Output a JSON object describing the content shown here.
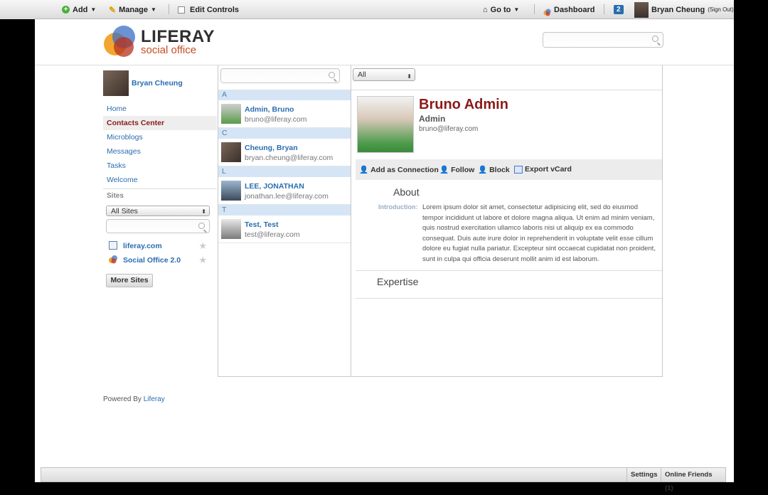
{
  "dockbar": {
    "add_label": "Add",
    "manage_label": "Manage",
    "edit_controls_label": "Edit Controls",
    "goto_label": "Go to",
    "dashboard_label": "Dashboard",
    "notification_count": "2",
    "user_name": "Bryan Cheung",
    "sign_out_label": "(Sign Out)"
  },
  "logo": {
    "main": "LIFERAY",
    "sub": "social office"
  },
  "sidebar": {
    "user_name": "Bryan Cheung",
    "nav_items": [
      {
        "label": "Home"
      },
      {
        "label": "Contacts Center",
        "active": true
      },
      {
        "label": "Microblogs"
      },
      {
        "label": "Messages"
      },
      {
        "label": "Tasks"
      },
      {
        "label": "Welcome"
      }
    ],
    "sites_heading": "Sites",
    "sites_filter_selected": "All Sites",
    "sites": [
      {
        "label": "liferay.com",
        "icon": "page-icon"
      },
      {
        "label": "Social Office 2.0",
        "icon": "social-office-icon"
      }
    ],
    "more_sites_label": "More Sites"
  },
  "contacts": {
    "filter_selected": "All",
    "groups": [
      {
        "letter": "A",
        "items": [
          {
            "name": "Admin, Bruno",
            "email": "bruno@liferay.com"
          }
        ]
      },
      {
        "letter": "C",
        "items": [
          {
            "name": "Cheung, Bryan",
            "email": "bryan.cheung@liferay.com"
          }
        ]
      },
      {
        "letter": "L",
        "items": [
          {
            "name": "LEE, JONATHAN",
            "email": "jonathan.lee@liferay.com"
          }
        ]
      },
      {
        "letter": "T",
        "items": [
          {
            "name": "Test, Test",
            "email": "test@liferay.com"
          }
        ]
      }
    ]
  },
  "profile": {
    "full_name": "Bruno Admin",
    "job_title": "Admin",
    "email": "bruno@liferay.com",
    "actions": {
      "add_connection": "Add as Connection",
      "follow": "Follow",
      "block": "Block",
      "export_vcard": "Export vCard"
    },
    "about_heading": "About",
    "intro_label": "Introduction:",
    "intro_text": "Lorem ipsum dolor sit amet, consectetur adipisicing elit, sed do eiusmod tempor incididunt ut labore et dolore magna aliqua. Ut enim ad minim veniam, quis nostrud exercitation ullamco laboris nisi ut aliquip ex ea commodo consequat. Duis aute irure dolor in reprehenderit in voluptate velit esse cillum dolore eu fugiat nulla pariatur. Excepteur sint occaecat cupidatat non proident, sunt in culpa qui officia deserunt mollit anim id est laborum.",
    "expertise_heading": "Expertise"
  },
  "footer": {
    "powered_by": "Powered By",
    "powered_link": "Liferay"
  },
  "bottom_bar": {
    "settings_label": "Settings",
    "online_friends_label": "Online Friends (1)"
  },
  "colors": {
    "accent_red": "#8b1a1a",
    "link_blue": "#2a6db0",
    "letter_bar": "#d5e5f5"
  }
}
